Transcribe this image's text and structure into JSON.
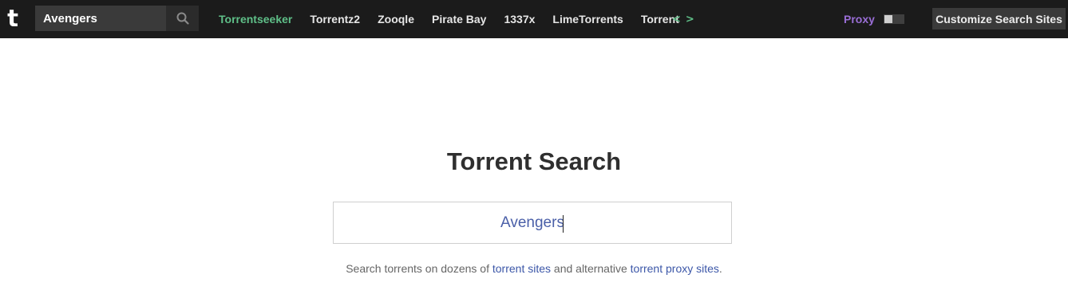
{
  "header": {
    "logo_text": "t",
    "search": {
      "value": "Avengers",
      "icon": "search-icon"
    },
    "sites": [
      {
        "label": "Torrentseeker",
        "active": true
      },
      {
        "label": "Torrentz2",
        "active": false
      },
      {
        "label": "Zooqle",
        "active": false
      },
      {
        "label": "Pirate Bay",
        "active": false
      },
      {
        "label": "1337x",
        "active": false
      },
      {
        "label": "LimeTorrents",
        "active": false
      },
      {
        "label": "Torrent",
        "active": false
      }
    ],
    "prev_arrow": "<",
    "next_arrow": ">",
    "proxy_label": "Proxy",
    "proxy_enabled": false,
    "customize_label": "Customize Search Sites"
  },
  "main": {
    "title": "Torrent Search",
    "search_value": "Avengers",
    "subtext": {
      "prefix": "Search torrents on dozens of ",
      "link1": "torrent sites",
      "middle": " and alternative ",
      "link2": "torrent proxy sites",
      "suffix": "."
    }
  },
  "colors": {
    "topbar_bg": "#1b1b1b",
    "active_site": "#5fbf88",
    "proxy": "#9a6ed6",
    "link": "#3c57a8",
    "search_text": "#4a5fa8"
  }
}
